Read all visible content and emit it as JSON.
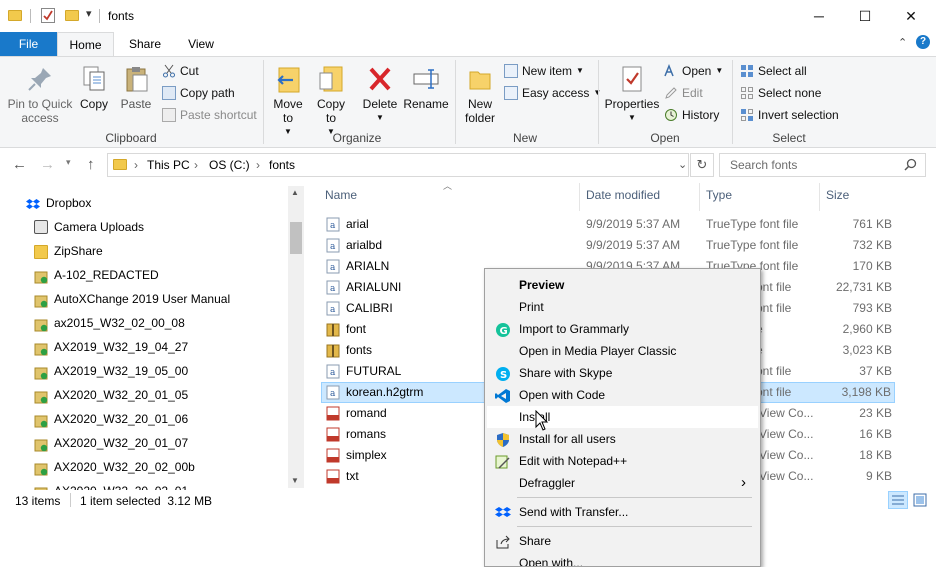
{
  "window": {
    "title": "fonts",
    "controls": {
      "minimize": "─",
      "maximize": "☐",
      "close": "✕"
    }
  },
  "tabs": {
    "file": "File",
    "home": "Home",
    "share": "Share",
    "view": "View"
  },
  "ribbon": {
    "clipboard": {
      "label": "Clipboard",
      "pin": "Pin to Quick access",
      "copy": "Copy",
      "paste": "Paste",
      "cut": "Cut",
      "copy_path": "Copy path",
      "paste_shortcut": "Paste shortcut"
    },
    "organize": {
      "label": "Organize",
      "move_to": "Move to",
      "copy_to": "Copy to",
      "delete": "Delete",
      "rename": "Rename"
    },
    "new": {
      "label": "New",
      "new_folder": "New folder",
      "new_item": "New item",
      "easy_access": "Easy access"
    },
    "open": {
      "label": "Open",
      "properties": "Properties",
      "open": "Open",
      "edit": "Edit",
      "history": "History"
    },
    "select": {
      "label": "Select",
      "select_all": "Select all",
      "select_none": "Select none",
      "invert_selection": "Invert selection"
    }
  },
  "address": {
    "crumbs": [
      "This PC",
      "OS (C:)",
      "fonts"
    ],
    "search_placeholder": "Search fonts"
  },
  "nav_pane": {
    "items": [
      "Dropbox",
      "Camera Uploads",
      "ZipShare",
      "A-102_REDACTED",
      "AutoXChange 2019 User Manual",
      "ax2015_W32_02_00_08",
      "AX2019_W32_19_04_27",
      "AX2019_W32_19_05_00",
      "AX2020_W32_20_01_05",
      "AX2020_W32_20_01_06",
      "AX2020_W32_20_01_07",
      "AX2020_W32_20_02_00b",
      "AX2020_W32_20_02_01"
    ]
  },
  "columns": {
    "name": "Name",
    "date": "Date modified",
    "type": "Type",
    "size": "Size"
  },
  "files": [
    {
      "name": "arial",
      "date": "9/9/2019 5:37 AM",
      "type": "TrueType font file",
      "size": "761 KB",
      "icon": "font-file-icon"
    },
    {
      "name": "arialbd",
      "date": "9/9/2019 5:37 AM",
      "type": "TrueType font file",
      "size": "732 KB",
      "icon": "font-file-icon"
    },
    {
      "name": "ARIALN",
      "date": "9/9/2019 5:37 AM",
      "type": "TrueType font file",
      "size": "170 KB",
      "icon": "font-file-icon"
    },
    {
      "name": "ARIALUNI",
      "date": "",
      "type": "ont file",
      "size": "22,731 KB",
      "icon": "font-file-icon"
    },
    {
      "name": "CALIBRI",
      "date": "",
      "type": "ont file",
      "size": "793 KB",
      "icon": "font-file-icon"
    },
    {
      "name": "font",
      "date": "",
      "type": "e",
      "size": "2,960 KB",
      "icon": "archive-icon"
    },
    {
      "name": "fonts",
      "date": "",
      "type": "e",
      "size": "3,023 KB",
      "icon": "archive-icon"
    },
    {
      "name": "FUTURAL",
      "date": "",
      "type": "ont file",
      "size": "37 KB",
      "icon": "font-file-icon"
    },
    {
      "name": "korean.h2gtrm",
      "date": "",
      "type": "ont file",
      "size": "3,198 KB",
      "icon": "font-file-icon"
    },
    {
      "name": "romand",
      "date": "",
      "type": "View Co...",
      "size": "23 KB",
      "icon": "shx-file-icon"
    },
    {
      "name": "romans",
      "date": "",
      "type": "View Co...",
      "size": "16 KB",
      "icon": "shx-file-icon"
    },
    {
      "name": "simplex",
      "date": "",
      "type": "View Co...",
      "size": "18 KB",
      "icon": "shx-file-icon"
    },
    {
      "name": "txt",
      "date": "",
      "type": "View Co...",
      "size": "9 KB",
      "icon": "shx-file-icon"
    }
  ],
  "status": {
    "count": "13 items",
    "selection": "1 item selected  3.12 MB"
  },
  "context_menu": {
    "items": [
      {
        "label": "Preview",
        "bold": true
      },
      {
        "label": "Print"
      },
      {
        "label": "Import to Grammarly",
        "icon": "grammarly-icon"
      },
      {
        "label": "Open in Media Player Classic"
      },
      {
        "label": "Share with Skype",
        "icon": "skype-icon"
      },
      {
        "label": "Open with Code",
        "icon": "vscode-icon"
      },
      {
        "label": "Install",
        "hover": true
      },
      {
        "label": "Install for all users",
        "icon": "shield-icon"
      },
      {
        "label": "Edit with Notepad++",
        "icon": "notepad-icon"
      },
      {
        "label": "Defraggler",
        "submenu": true
      },
      {
        "label": "Send with Transfer...",
        "icon": "dropbox-icon"
      },
      {
        "label": "Share",
        "icon": "share-icon"
      },
      {
        "label": "Open with..."
      }
    ],
    "submenu_glyph": "›"
  },
  "colors": {
    "accent": "#1979ca",
    "selection": "#cce8ff",
    "selection_border": "#99d1ff"
  }
}
